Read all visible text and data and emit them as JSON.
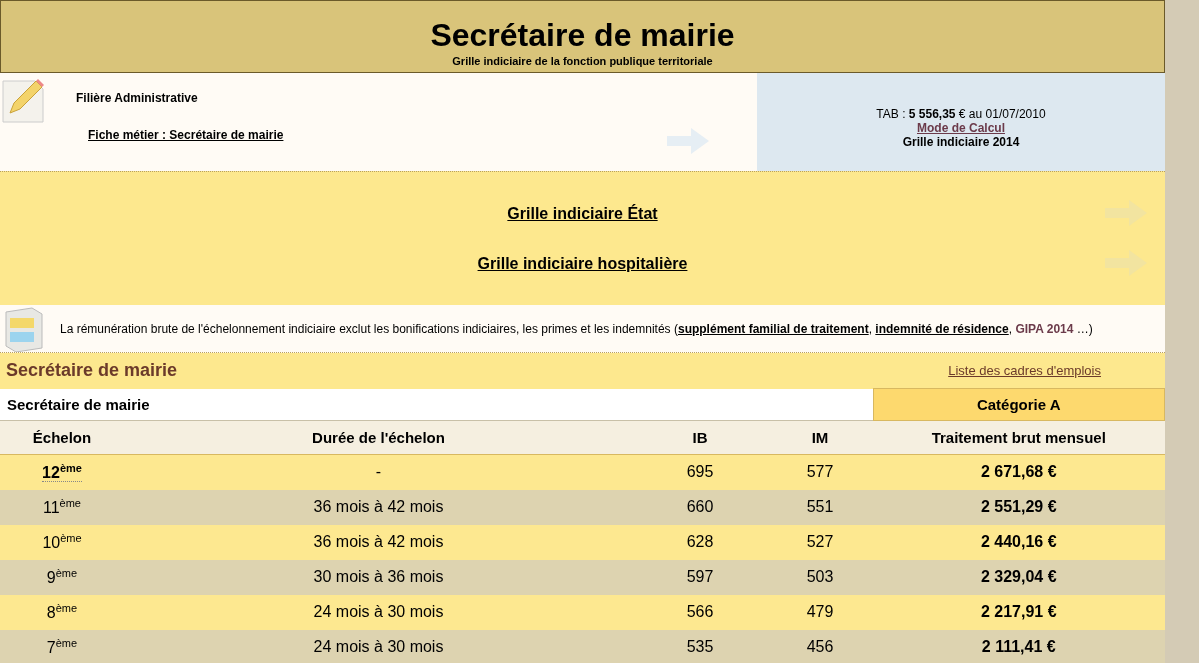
{
  "header": {
    "title": "Secrétaire de mairie",
    "subtitle": "Grille indiciaire de la fonction publique territoriale"
  },
  "info": {
    "filiere": "Filière Administrative",
    "fiche_link": "Fiche métier : Secrétaire de mairie",
    "tab": "TAB : **5 556,35** € au 01/07/2010",
    "mode_link": "Mode de Calcul",
    "grille": "Grille indiciaire 2014"
  },
  "other_grids": [
    "Grille indiciaire État",
    "Grille indiciaire hospitalière"
  ],
  "notice": [
    {
      "kind": "text",
      "text": "La rémunération brute de l'échelonnement indiciaire exclut les bonifications indiciaires, les primes et les indemnités ("
    },
    {
      "kind": "link",
      "text": "supplément familial de traitement"
    },
    {
      "kind": "text",
      "text": ", "
    },
    {
      "kind": "link",
      "text": "indemnité de résidence"
    },
    {
      "kind": "text",
      "text": ", "
    },
    {
      "kind": "emph",
      "text": "GIPA 2014"
    },
    {
      "kind": "text",
      "text": " …)"
    }
  ],
  "section": {
    "title": "Secrétaire de mairie",
    "link": "Liste des cadres d'emplois"
  },
  "table": {
    "name": "Secrétaire de mairie",
    "category": "Catégorie A",
    "columns": [
      "Échelon",
      "Durée de l'échelon",
      "IB",
      "IM",
      "Traitement brut mensuel"
    ],
    "rows": [
      {
        "echelon": "12$^{ème}$",
        "duree": "-",
        "ib": "695",
        "im": "577",
        "traitement": "2 671,68 €",
        "top": true
      },
      {
        "echelon": "11$^{ème}$",
        "duree": "36 mois à 42 mois",
        "ib": "660",
        "im": "551",
        "traitement": "2 551,29 €",
        "top": false
      },
      {
        "echelon": "10$^{ème}$",
        "duree": "36 mois à 42 mois",
        "ib": "628",
        "im": "527",
        "traitement": "2 440,16 €",
        "top": false
      },
      {
        "echelon": "9$^{ème}$",
        "duree": "30 mois à 36 mois",
        "ib": "597",
        "im": "503",
        "traitement": "2 329,04 €",
        "top": false
      },
      {
        "echelon": "8$^{ème}$",
        "duree": "24 mois à 30 mois",
        "ib": "566",
        "im": "479",
        "traitement": "2 217,91 €",
        "top": false
      },
      {
        "echelon": "7$^{ème}$",
        "duree": "24 mois à 30 mois",
        "ib": "535",
        "im": "456",
        "traitement": "2 111,41 €",
        "top": false
      }
    ]
  }
}
